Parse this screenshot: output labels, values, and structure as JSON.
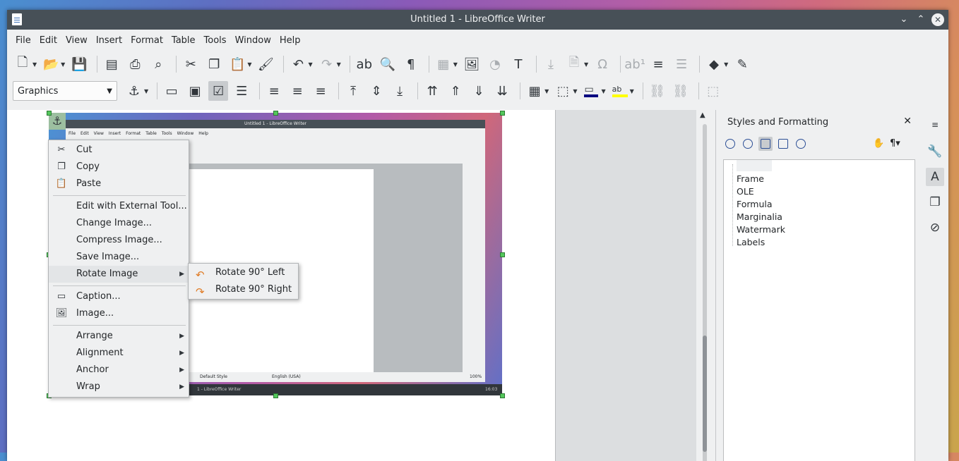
{
  "window": {
    "title": "Untitled 1 - LibreOffice Writer"
  },
  "menubar": [
    "File",
    "Edit",
    "View",
    "Insert",
    "Format",
    "Table",
    "Tools",
    "Window",
    "Help"
  ],
  "toolbar2": {
    "paragraph_style": "Graphics"
  },
  "context_menu": {
    "items": [
      {
        "label": "Cut",
        "icon": "scissors-icon"
      },
      {
        "label": "Copy",
        "icon": "copy-icon"
      },
      {
        "label": "Paste",
        "icon": "paste-icon"
      },
      {
        "label": "Edit with External Tool..."
      },
      {
        "label": "Change Image..."
      },
      {
        "label": "Compress Image..."
      },
      {
        "label": "Save Image..."
      },
      {
        "label": "Rotate Image",
        "submenu": true
      },
      {
        "label": "Caption...",
        "icon": "caption-icon"
      },
      {
        "label": "Image...",
        "icon": "image-icon"
      },
      {
        "label": "Arrange",
        "submenu": true
      },
      {
        "label": "Alignment",
        "submenu": true
      },
      {
        "label": "Anchor",
        "submenu": true
      },
      {
        "label": "Wrap",
        "submenu": true
      }
    ]
  },
  "rotate_submenu": {
    "items": [
      {
        "label": "Rotate 90° Left",
        "icon": "rotate-left-icon"
      },
      {
        "label": "Rotate 90° Right",
        "icon": "rotate-right-icon"
      }
    ]
  },
  "sidebar": {
    "title": "Styles and Formatting",
    "styles": [
      "Frame",
      "OLE",
      "Formula",
      "Marginalia",
      "Watermark",
      "Labels"
    ]
  },
  "embedded_screenshot": {
    "title": "Untitled 1 - LibreOffice Writer",
    "menu": [
      "File",
      "Edit",
      "View",
      "Insert",
      "Format",
      "Table",
      "Tools",
      "Window",
      "Help"
    ],
    "status_style": "Default Style",
    "status_lang": "English (USA)",
    "zoom": "100%",
    "taskbar_label": "1 - LibreOffice Writer",
    "clock": "16:03"
  },
  "colors": {
    "titlebar": "#475057",
    "window_bg": "#eff0f1",
    "accent_font": "#000080",
    "highlight": "#ffff00"
  }
}
